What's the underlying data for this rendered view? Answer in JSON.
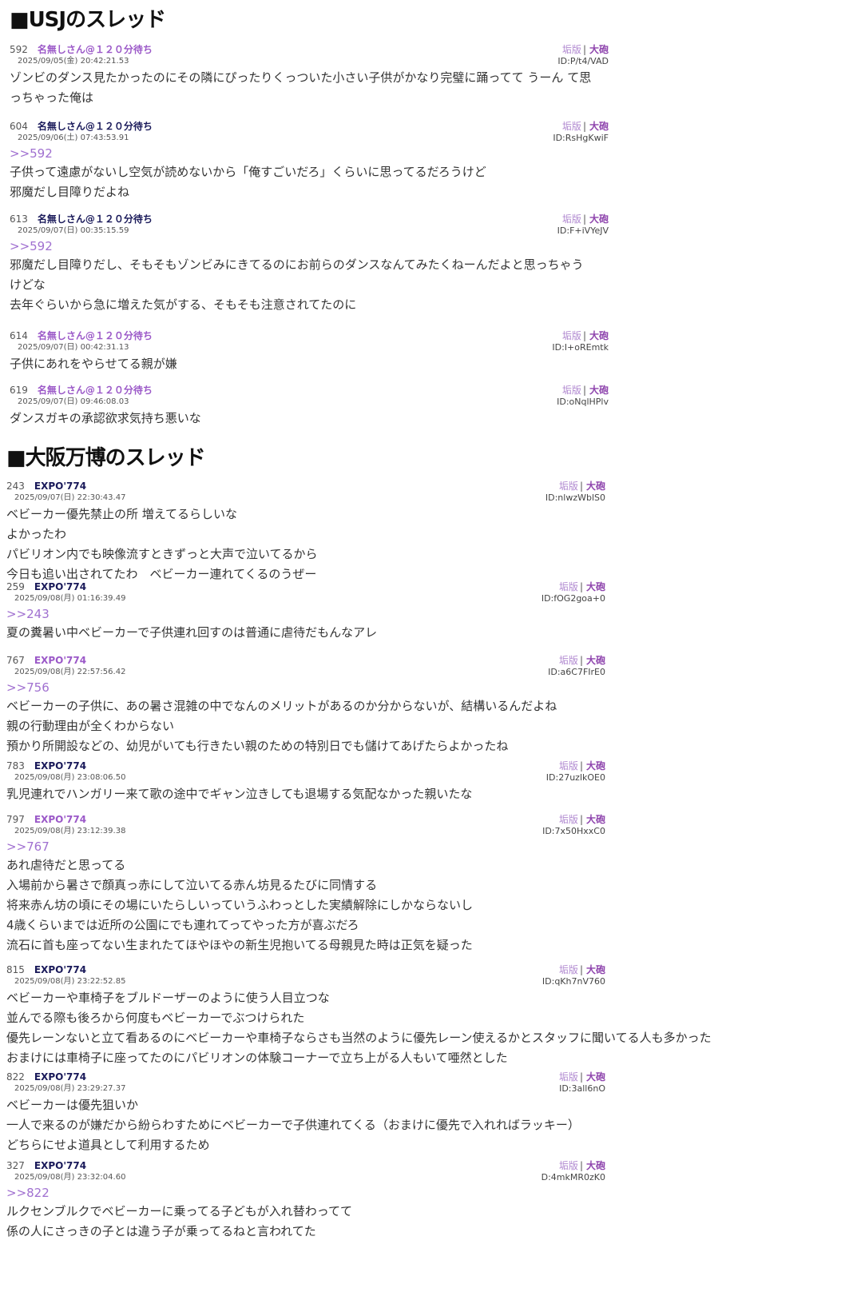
{
  "sections": [
    {
      "title": "■USJのスレッド",
      "posts": [
        {
          "num": "592",
          "name": "名無しさん@１２０分待ち",
          "name_style": "purple",
          "date": "2025/09/05(金) 20:42:21.53",
          "link1": "垢版",
          "link2": "大砲",
          "id": "ID:P/t4/VAD",
          "anchor": "",
          "lines": [
            "ゾンビのダンス見たかったのにその隣にぴったりくっついた小さい子供がかなり完璧に踊ってて うーん て思",
            "っちゃった俺は"
          ]
        },
        {
          "num": "604",
          "name": "名無しさん@１２０分待ち",
          "name_style": "dark",
          "date": "2025/09/06(土) 07:43:53.91",
          "link1": "垢版",
          "link2": "大砲",
          "id": "ID:RsHgKwiF",
          "anchor": ">>592",
          "lines": [
            "子供って遠慮がないし空気が読めないから「俺すごいだろ」くらいに思ってるだろうけど",
            "邪魔だし目障りだよね"
          ]
        },
        {
          "num": "613",
          "name": "名無しさん@１２０分待ち",
          "name_style": "dark",
          "date": "2025/09/07(日) 00:35:15.59",
          "link1": "垢版",
          "link2": "大砲",
          "id": "ID:F+iVYeJV",
          "anchor": ">>592",
          "lines": [
            "邪魔だし目障りだし、そもそもゾンビみにきてるのにお前らのダンスなんてみたくねーんだよと思っちゃう",
            "けどな",
            "去年ぐらいから急に増えた気がする、そもそも注意されてたのに"
          ]
        },
        {
          "num": "614",
          "name": "名無しさん@１２０分待ち",
          "name_style": "purple",
          "date": "2025/09/07(日) 00:42:31.13",
          "link1": "垢版",
          "link2": "大砲",
          "id": "ID:I+oREmtk",
          "anchor": "",
          "lines": [
            "子供にあれをやらせてる親が嫌"
          ]
        },
        {
          "num": "619",
          "name": "名無しさん@１２０分待ち",
          "name_style": "purple",
          "date": "2025/09/07(日) 09:46:08.03",
          "link1": "垢版",
          "link2": "大砲",
          "id": "ID:oNqlHPlv",
          "anchor": "",
          "lines": [
            "ダンスガキの承認欲求気持ち悪いな"
          ]
        }
      ]
    },
    {
      "title": "■大阪万博のスレッド",
      "posts": [
        {
          "num": "243",
          "name": "EXPO'774",
          "name_style": "dark",
          "date": "2025/09/07(日) 22:30:43.47",
          "link1": "垢版",
          "link2": "大砲",
          "id": "ID:nlwzWblS0",
          "anchor": "",
          "lines": [
            "ベビーカー優先禁止の所 増えてるらしいな",
            "よかったわ",
            "パビリオン内でも映像流すときずっと大声で泣いてるから",
            "今日も追い出されてたわ　ベビーカー連れてくるのうぜー"
          ]
        },
        {
          "num": "259",
          "name": "EXPO'774",
          "name_style": "dark",
          "date": "2025/09/08(月) 01:16:39.49",
          "link1": "垢版",
          "link2": "大砲",
          "id": "ID:fOG2goa+0",
          "anchor": ">>243",
          "lines": [
            "夏の糞暑い中ベビーカーで子供連れ回すのは普通に虐待だもんなアレ"
          ]
        },
        {
          "num": "767",
          "name": "EXPO'774",
          "name_style": "purple",
          "date": "2025/09/08(月) 22:57:56.42",
          "link1": "垢版",
          "link2": "大砲",
          "id": "ID:a6C7FIrE0",
          "anchor": ">>756",
          "lines": [
            "ベビーカーの子供に、あの暑さ混雑の中でなんのメリットがあるのか分からないが、結構いるんだよね",
            "親の行動理由が全くわからない",
            "預かり所開設などの、幼児がいても行きたい親のための特別日でも儲けてあげたらよかったね"
          ]
        },
        {
          "num": "783",
          "name": "EXPO'774",
          "name_style": "dark",
          "date": "2025/09/08(月) 23:08:06.50",
          "link1": "垢版",
          "link2": "大砲",
          "id": "ID:27uzlkOE0",
          "anchor": "",
          "lines": [
            "乳児連れでハンガリー来て歌の途中でギャン泣きしても退場する気配なかった親いたな"
          ]
        },
        {
          "num": "797",
          "name": "EXPO'774",
          "name_style": "purple",
          "date": "2025/09/08(月) 23:12:39.38",
          "link1": "垢版",
          "link2": "大砲",
          "id": "ID:7x50HxxC0",
          "anchor": ">>767",
          "lines": [
            "あれ虐待だと思ってる",
            "入場前から暑さで顔真っ赤にして泣いてる赤ん坊見るたびに同情する",
            "将来赤ん坊の頃にその場にいたらしいっていうふわっとした実績解除にしかならないし",
            "4歳くらいまでは近所の公園にでも連れてってやった方が喜ぶだろ",
            "流石に首も座ってない生まれたてほやほやの新生児抱いてる母親見た時は正気を疑った"
          ]
        },
        {
          "num": "815",
          "name": "EXPO'774",
          "name_style": "dark",
          "date": "2025/09/08(月) 23:22:52.85",
          "link1": "垢版",
          "link2": "大砲",
          "id": "ID:qKh7nV760",
          "anchor": "",
          "lines": [
            "ベビーカーや車椅子をブルドーザーのように使う人目立つな",
            "並んでる際も後ろから何度もベビーカーでぶつけられた",
            "優先レーンないと立て看あるのにベビーカーや車椅子ならさも当然のように優先レーン使えるかとスタッフに聞いてる人も多かった",
            "おまけには車椅子に座ってたのにパビリオンの体験コーナーで立ち上がる人もいて唖然とした"
          ]
        },
        {
          "num": "822",
          "name": "EXPO'774",
          "name_style": "dark",
          "date": "2025/09/08(月) 23:29:27.37",
          "link1": "垢版",
          "link2": "大砲",
          "id": "ID:3all6nO",
          "anchor": "",
          "lines": [
            "ベビーカーは優先狙いか",
            "一人で来るのが嫌だから紛らわすためにベビーカーで子供連れてくる（おまけに優先で入れればラッキー）",
            "どちらにせよ道具として利用するため"
          ]
        },
        {
          "num": "327",
          "name": "EXPO'774",
          "name_style": "dark",
          "date": "2025/09/08(月) 23:32:04.60",
          "link1": "垢版",
          "link2": "大砲",
          "id": "D:4mkMR0zK0",
          "anchor": ">>822",
          "lines": [
            "ルクセンブルクでベビーカーに乗ってる子どもが入れ替わってて",
            "係の人にさっきの子とは違う子が乗ってるねと言われてた"
          ]
        }
      ]
    }
  ]
}
